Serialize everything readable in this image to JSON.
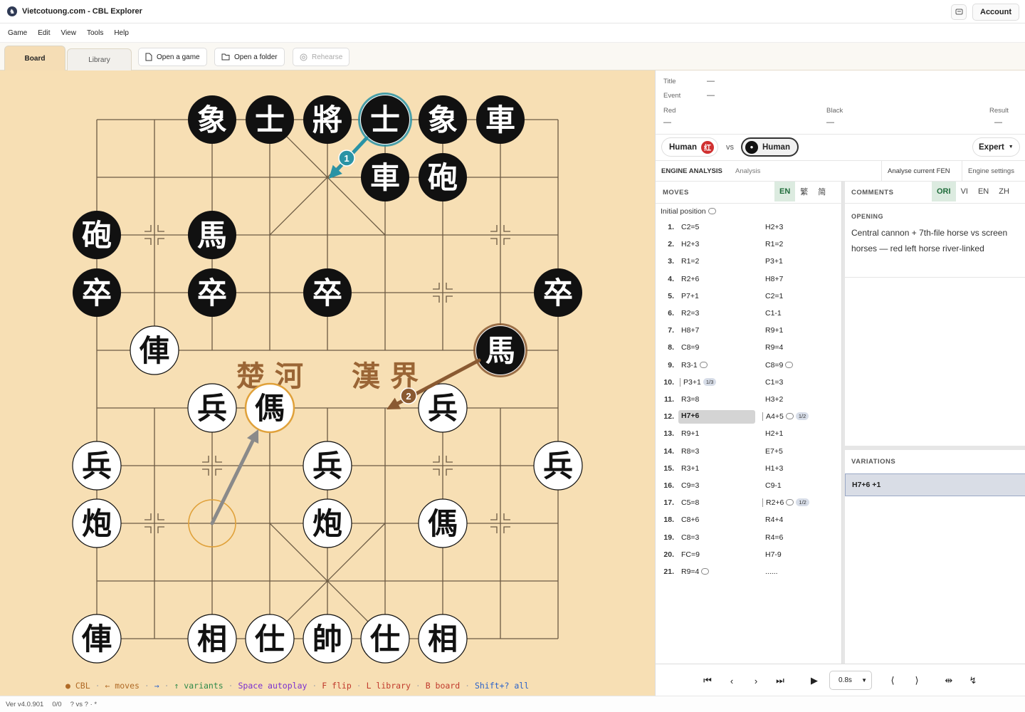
{
  "window": {
    "title": "Vietcotuong.com - CBL Explorer",
    "account_label": "Account"
  },
  "menu": [
    "Game",
    "Edit",
    "View",
    "Tools",
    "Help"
  ],
  "toolbar": {
    "tab_board": "Board",
    "tab_library": "Library",
    "open_game": "Open a game",
    "open_folder": "Open a folder",
    "rehearse": "Rehearse"
  },
  "board": {
    "river_left": "楚 河",
    "river_right": "漢 界",
    "arrow1_num": "1",
    "arrow2_num": "2",
    "pieces": [
      {
        "c": "象",
        "side": "black",
        "f": 3,
        "r": 0
      },
      {
        "c": "士",
        "side": "black",
        "f": 4,
        "r": 0
      },
      {
        "c": "將",
        "side": "black",
        "f": 5,
        "r": 0
      },
      {
        "c": "士",
        "side": "black",
        "f": 6,
        "r": 0,
        "hl": "teal"
      },
      {
        "c": "象",
        "side": "black",
        "f": 7,
        "r": 0
      },
      {
        "c": "車",
        "side": "black",
        "f": 8,
        "r": 0
      },
      {
        "c": "車",
        "side": "black",
        "f": 6,
        "r": 1
      },
      {
        "c": "砲",
        "side": "black",
        "f": 7,
        "r": 1
      },
      {
        "c": "砲",
        "side": "black",
        "f": 1,
        "r": 2
      },
      {
        "c": "馬",
        "side": "black",
        "f": 3,
        "r": 2
      },
      {
        "c": "卒",
        "side": "black",
        "f": 1,
        "r": 3
      },
      {
        "c": "卒",
        "side": "black",
        "f": 3,
        "r": 3
      },
      {
        "c": "卒",
        "side": "black",
        "f": 5,
        "r": 3
      },
      {
        "c": "卒",
        "side": "black",
        "f": 9,
        "r": 3
      },
      {
        "c": "馬",
        "side": "black",
        "f": 8,
        "r": 4,
        "hl": "brown"
      },
      {
        "c": "俥",
        "side": "red",
        "f": 2,
        "r": 4
      },
      {
        "c": "兵",
        "side": "red",
        "f": 3,
        "r": 5
      },
      {
        "c": "傌",
        "side": "red",
        "f": 4,
        "r": 5,
        "hl": "gold"
      },
      {
        "c": "兵",
        "side": "red",
        "f": 7,
        "r": 5
      },
      {
        "c": "兵",
        "side": "red",
        "f": 1,
        "r": 6
      },
      {
        "c": "兵",
        "side": "red",
        "f": 5,
        "r": 6
      },
      {
        "c": "兵",
        "side": "red",
        "f": 9,
        "r": 6
      },
      {
        "c": "炮",
        "side": "red",
        "f": 1,
        "r": 7
      },
      {
        "c": "炮",
        "side": "red",
        "f": 5,
        "r": 7
      },
      {
        "c": "傌",
        "side": "red",
        "f": 7,
        "r": 7
      },
      {
        "c": "俥",
        "side": "red",
        "f": 1,
        "r": 9
      },
      {
        "c": "相",
        "side": "red",
        "f": 3,
        "r": 9
      },
      {
        "c": "仕",
        "side": "red",
        "f": 4,
        "r": 9
      },
      {
        "c": "帥",
        "side": "red",
        "f": 5,
        "r": 9
      },
      {
        "c": "仕",
        "side": "red",
        "f": 6,
        "r": 9
      },
      {
        "c": "相",
        "side": "red",
        "f": 7,
        "r": 9
      }
    ]
  },
  "hints": {
    "cbl": "CBL",
    "moves": "← moves",
    "arrow_right": "→",
    "variants": "↑ variants",
    "autoplay": "Space autoplay",
    "flip": "F flip",
    "library": "L library",
    "board": "B board",
    "all": "Shift+? all"
  },
  "status": {
    "version": "Ver v4.0.901",
    "count": "0/0",
    "players": "? vs ? · *"
  },
  "meta": {
    "title_label": "Title",
    "title_value": "—",
    "event_label": "Event",
    "event_value": "—",
    "red_label": "Red",
    "red_value": "—",
    "black_label": "Black",
    "black_value": "—",
    "result_label": "Result",
    "result_value": "—"
  },
  "players": {
    "red": "Human",
    "red_badge": "红",
    "vs": "vs",
    "black": "Human",
    "level": "Expert"
  },
  "engine": {
    "title": "ENGINE ANALYSIS",
    "sub": "Analysis",
    "analyse": "Analyse current FEN",
    "settings": "Engine settings"
  },
  "moves": {
    "header": "MOVES",
    "langs": [
      "EN",
      "繁",
      "简"
    ],
    "initial": "Initial position",
    "rows": [
      {
        "n": "1.",
        "w": "C2=5",
        "b": "H2+3"
      },
      {
        "n": "2.",
        "w": "H2+3",
        "b": "R1=2"
      },
      {
        "n": "3.",
        "w": "R1=2",
        "b": "P3+1"
      },
      {
        "n": "4.",
        "w": "R2+6",
        "b": "H8+7"
      },
      {
        "n": "5.",
        "w": "P7+1",
        "b": "C2=1"
      },
      {
        "n": "6.",
        "w": "R2=3",
        "b": "C1-1"
      },
      {
        "n": "7.",
        "w": "H8+7",
        "b": "R9+1"
      },
      {
        "n": "8.",
        "w": "C8=9",
        "b": "R9=4"
      },
      {
        "n": "9.",
        "w": "R3-1",
        "b": "C8=9",
        "wc": true,
        "bc": true
      },
      {
        "n": "10.",
        "w": "P3+1",
        "b": "C1=3",
        "wv": "1/3"
      },
      {
        "n": "11.",
        "w": "R3=8",
        "b": "H3+2"
      },
      {
        "n": "12.",
        "w": "H7+6",
        "b": "A4+5",
        "bc": true,
        "bv": "1/2",
        "sel": true
      },
      {
        "n": "13.",
        "w": "R9+1",
        "b": "H2+1"
      },
      {
        "n": "14.",
        "w": "R8=3",
        "b": "E7+5"
      },
      {
        "n": "15.",
        "w": "R3+1",
        "b": "H1+3"
      },
      {
        "n": "16.",
        "w": "C9=3",
        "b": "C9-1"
      },
      {
        "n": "17.",
        "w": "C5=8",
        "b": "R2+6",
        "bc": true,
        "bv": "1/2"
      },
      {
        "n": "18.",
        "w": "C8+6",
        "b": "R4+4"
      },
      {
        "n": "19.",
        "w": "C8=3",
        "b": "R4=6"
      },
      {
        "n": "20.",
        "w": "FC=9",
        "b": "H7-9"
      },
      {
        "n": "21.",
        "w": "R9=4",
        "b": "......",
        "wc": true
      }
    ]
  },
  "comments": {
    "header": "COMMENTS",
    "langs": [
      "ORI",
      "VI",
      "EN",
      "ZH"
    ],
    "opening_label": "OPENING",
    "opening_text": "Central cannon + 7th-file horse vs screen horses — red left horse river-linked"
  },
  "variations": {
    "header": "VARIATIONS",
    "items": [
      "H7+6 +1"
    ]
  },
  "nav": {
    "speed": "0.8s"
  },
  "colors": {
    "board_bg": "#f7dfb4",
    "line": "#6b5a43",
    "black_piece": "#111111",
    "red_text": "#111111",
    "teal": "#2a93a5",
    "brown": "#8a5a32",
    "gold": "#e0a13a"
  }
}
